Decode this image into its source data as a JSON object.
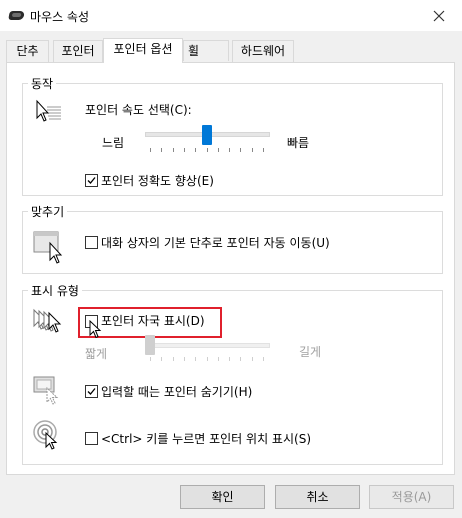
{
  "window": {
    "title": "마우스 속성"
  },
  "tabs": [
    {
      "label": "단추"
    },
    {
      "label": "포인터"
    },
    {
      "label": "포인터 옵션"
    },
    {
      "label": "휠"
    },
    {
      "label": "하드웨어"
    }
  ],
  "active_tab": "포인터 옵션",
  "motion": {
    "title": "동작",
    "speed_label": "포인터 속도 선택(C):",
    "slow_label": "느림",
    "fast_label": "빠름",
    "speed_level": 0.5,
    "precision": {
      "label": "포인터 정확도 향상(E)",
      "checked": true
    }
  },
  "snap_to": {
    "title": "맞추기",
    "option": {
      "label": "대화 상자의 기본 단추로 포인터 자동 이동(U)",
      "checked": false
    }
  },
  "visibility": {
    "title": "표시 유형",
    "trails": {
      "label": "포인터 자국 표시(D)",
      "checked": false
    },
    "short_label": "짧게",
    "long_label": "길게",
    "trail_level": 0,
    "hide_typing": {
      "label": "입력할 때는 포인터 숨기기(H)",
      "checked": true
    },
    "ctrl_show": {
      "label": "<Ctrl> 키를 누르면 포인터 위치 표시(S)",
      "checked": false
    }
  },
  "buttons": {
    "ok": "확인",
    "cancel": "취소",
    "apply": "적용(A)"
  },
  "colors": {
    "accent": "#0078d7",
    "highlight": "#e0202c"
  },
  "icons": [
    "mouse-icon",
    "close-icon",
    "pointer-speed-icon",
    "snap-to-icon",
    "pointer-trails-icon",
    "hide-pointer-icon",
    "pointer-location-icon",
    "cursor-icon"
  ]
}
